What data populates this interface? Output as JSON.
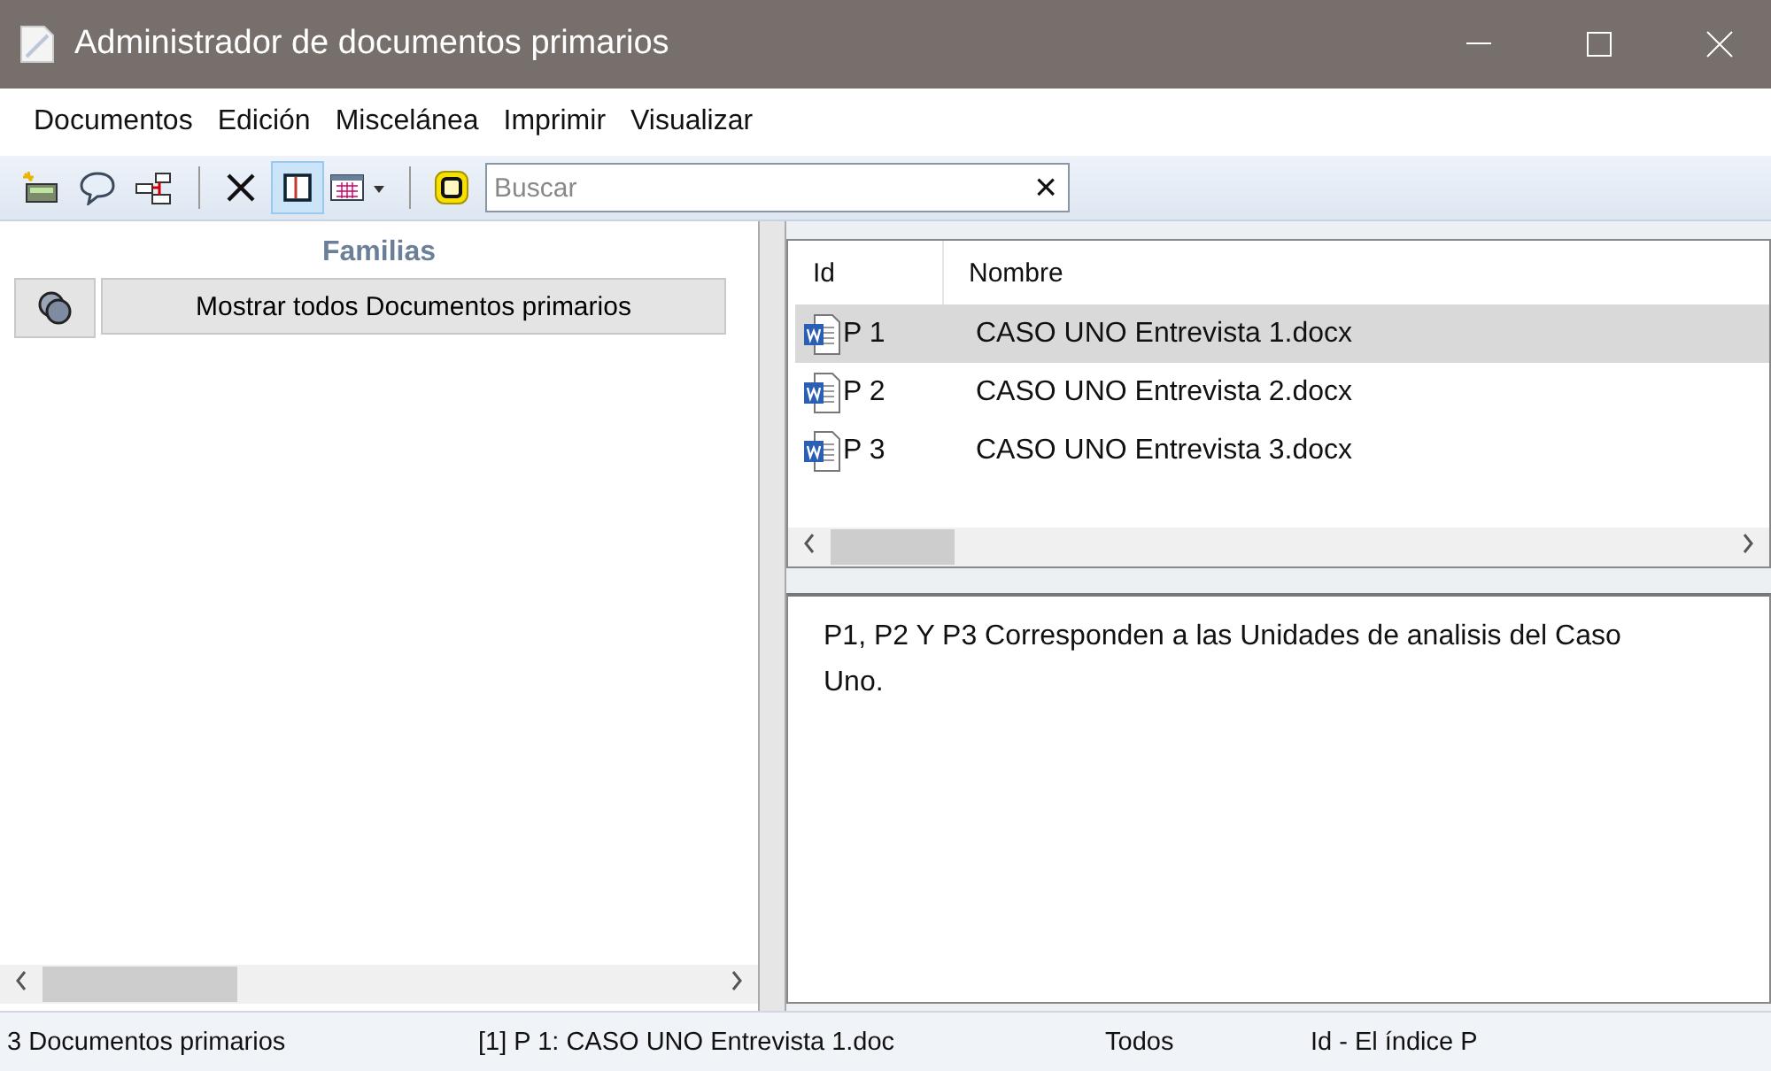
{
  "window": {
    "title": "Administrador de documentos primarios"
  },
  "menu": [
    "Documentos",
    "Edición",
    "Miscelánea",
    "Imprimir",
    "Visualizar"
  ],
  "toolbar": [
    {
      "kind": "new",
      "selected": false
    },
    {
      "kind": "comment",
      "selected": false
    },
    {
      "kind": "tree",
      "selected": false
    },
    {
      "kind": "separator"
    },
    {
      "kind": "delete",
      "selected": false
    },
    {
      "kind": "panel",
      "selected": true
    },
    {
      "kind": "grid",
      "selected": false
    },
    {
      "kind": "separator"
    },
    {
      "kind": "filter",
      "selected": false
    }
  ],
  "search": {
    "placeholder": "Buscar",
    "clear": "×"
  },
  "families": {
    "title": "Familias",
    "show_all": "Mostrar todos Documentos primarios"
  },
  "table": {
    "columns": [
      "Id",
      "Nombre"
    ],
    "rows": [
      {
        "id": "P 1",
        "name": "CASO UNO Entrevista 1.docx",
        "selected": true
      },
      {
        "id": "P 2",
        "name": "CASO UNO Entrevista 2.docx",
        "selected": false
      },
      {
        "id": "P 3",
        "name": "CASO UNO Entrevista 3.docx",
        "selected": false
      }
    ]
  },
  "comment": "P1, P2 Y P3 Corresponden a las Unidades de analisis del Caso Uno.",
  "status_bar": [
    "3 Documentos primarios",
    "[1] P 1: CASO UNO Entrevista 1.doc",
    "Todos",
    "Id - El índice P"
  ]
}
